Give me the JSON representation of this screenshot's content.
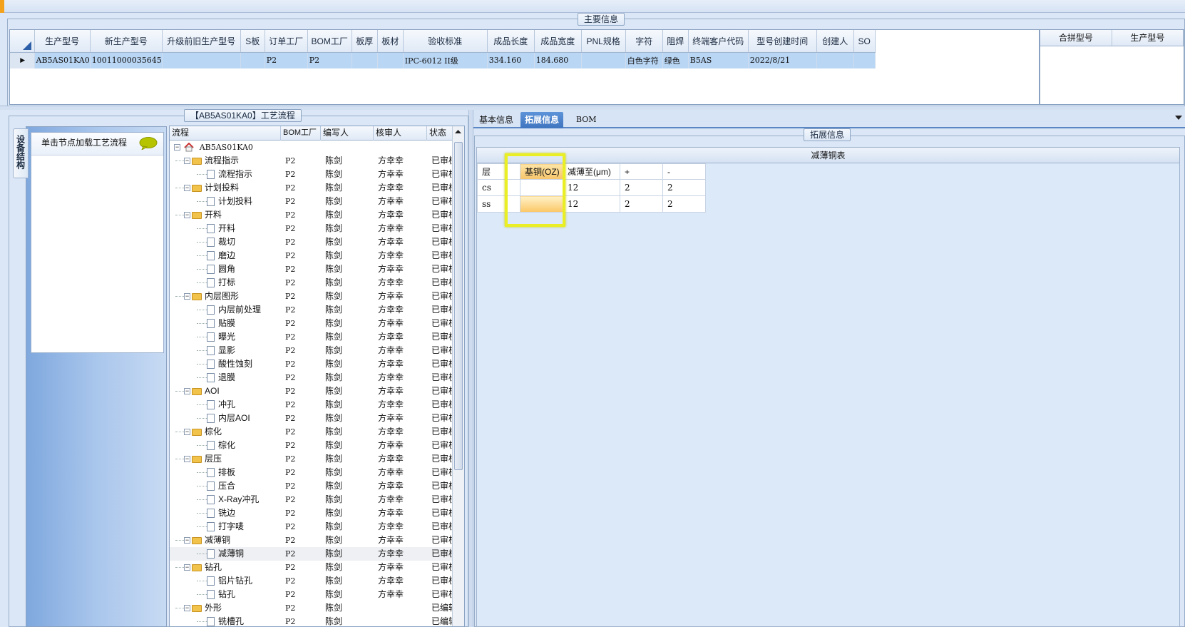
{
  "main_info": {
    "title": "主要信息",
    "columns": [
      "生产型号",
      "新生产型号",
      "升级前旧生产型号",
      "S板",
      "订单工厂",
      "BOM工厂",
      "板厚",
      "板材",
      "验收标准",
      "成品长度",
      "成品宽度",
      "PNL规格",
      "字符",
      "阻焊",
      "终端客户代码",
      "型号创建时间",
      "创建人",
      "SO"
    ],
    "row": [
      "AB5AS01KA0",
      "10011000035645",
      "",
      "",
      "P2",
      "P2",
      "",
      "",
      "IPC-6012 II级",
      "334.160",
      "184.680",
      "",
      "白色字符",
      "绿色",
      "B5AS",
      "2022/8/21",
      "",
      ""
    ]
  },
  "merge_panel": {
    "columns": [
      "合拼型号",
      "生产型号"
    ]
  },
  "process_flow": {
    "title": "【AB5AS01KA0】工艺流程",
    "side_tab": "设备结构",
    "hint": "单击节点加载工艺流程",
    "columns": [
      "流程",
      "BOM工厂",
      "编写人",
      "核审人",
      "状态"
    ],
    "root": "AB5AS01KA0",
    "rows": [
      {
        "label": "流程指示",
        "level": 1,
        "bom": "P2",
        "editor": "陈剑",
        "reviewer": "方幸幸",
        "status": "已审核"
      },
      {
        "label": "流程指示",
        "level": 2,
        "bom": "P2",
        "editor": "陈剑",
        "reviewer": "方幸幸",
        "status": "已审核"
      },
      {
        "label": "计划投料",
        "level": 1,
        "bom": "P2",
        "editor": "陈剑",
        "reviewer": "方幸幸",
        "status": "已审核"
      },
      {
        "label": "计划投料",
        "level": 2,
        "bom": "P2",
        "editor": "陈剑",
        "reviewer": "方幸幸",
        "status": "已审核"
      },
      {
        "label": "开料",
        "level": 1,
        "bom": "P2",
        "editor": "陈剑",
        "reviewer": "方幸幸",
        "status": "已审核"
      },
      {
        "label": "开料",
        "level": 2,
        "bom": "P2",
        "editor": "陈剑",
        "reviewer": "方幸幸",
        "status": "已审核"
      },
      {
        "label": "裁切",
        "level": 2,
        "bom": "P2",
        "editor": "陈剑",
        "reviewer": "方幸幸",
        "status": "已审核"
      },
      {
        "label": "磨边",
        "level": 2,
        "bom": "P2",
        "editor": "陈剑",
        "reviewer": "方幸幸",
        "status": "已审核"
      },
      {
        "label": "圆角",
        "level": 2,
        "bom": "P2",
        "editor": "陈剑",
        "reviewer": "方幸幸",
        "status": "已审核"
      },
      {
        "label": "打标",
        "level": 2,
        "bom": "P2",
        "editor": "陈剑",
        "reviewer": "方幸幸",
        "status": "已审核"
      },
      {
        "label": "内层图形",
        "level": 1,
        "bom": "P2",
        "editor": "陈剑",
        "reviewer": "方幸幸",
        "status": "已审核"
      },
      {
        "label": "内层前处理",
        "level": 2,
        "bom": "P2",
        "editor": "陈剑",
        "reviewer": "方幸幸",
        "status": "已审核"
      },
      {
        "label": "贴膜",
        "level": 2,
        "bom": "P2",
        "editor": "陈剑",
        "reviewer": "方幸幸",
        "status": "已审核"
      },
      {
        "label": "曝光",
        "level": 2,
        "bom": "P2",
        "editor": "陈剑",
        "reviewer": "方幸幸",
        "status": "已审核"
      },
      {
        "label": "显影",
        "level": 2,
        "bom": "P2",
        "editor": "陈剑",
        "reviewer": "方幸幸",
        "status": "已审核"
      },
      {
        "label": "酸性蚀刻",
        "level": 2,
        "bom": "P2",
        "editor": "陈剑",
        "reviewer": "方幸幸",
        "status": "已审核"
      },
      {
        "label": "退膜",
        "level": 2,
        "bom": "P2",
        "editor": "陈剑",
        "reviewer": "方幸幸",
        "status": "已审核"
      },
      {
        "label": "AOI",
        "level": 1,
        "bom": "P2",
        "editor": "陈剑",
        "reviewer": "方幸幸",
        "status": "已审核"
      },
      {
        "label": "冲孔",
        "level": 2,
        "bom": "P2",
        "editor": "陈剑",
        "reviewer": "方幸幸",
        "status": "已审核"
      },
      {
        "label": "内层AOI",
        "level": 2,
        "bom": "P2",
        "editor": "陈剑",
        "reviewer": "方幸幸",
        "status": "已审核"
      },
      {
        "label": "棕化",
        "level": 1,
        "bom": "P2",
        "editor": "陈剑",
        "reviewer": "方幸幸",
        "status": "已审核"
      },
      {
        "label": "棕化",
        "level": 2,
        "bom": "P2",
        "editor": "陈剑",
        "reviewer": "方幸幸",
        "status": "已审核"
      },
      {
        "label": "层压",
        "level": 1,
        "bom": "P2",
        "editor": "陈剑",
        "reviewer": "方幸幸",
        "status": "已审核"
      },
      {
        "label": "排板",
        "level": 2,
        "bom": "P2",
        "editor": "陈剑",
        "reviewer": "方幸幸",
        "status": "已审核"
      },
      {
        "label": "压合",
        "level": 2,
        "bom": "P2",
        "editor": "陈剑",
        "reviewer": "方幸幸",
        "status": "已审核"
      },
      {
        "label": "X-Ray冲孔",
        "level": 2,
        "bom": "P2",
        "editor": "陈剑",
        "reviewer": "方幸幸",
        "status": "已审核"
      },
      {
        "label": "铣边",
        "level": 2,
        "bom": "P2",
        "editor": "陈剑",
        "reviewer": "方幸幸",
        "status": "已审核"
      },
      {
        "label": "打字唛",
        "level": 2,
        "bom": "P2",
        "editor": "陈剑",
        "reviewer": "方幸幸",
        "status": "已审核"
      },
      {
        "label": "减薄铜",
        "level": 1,
        "bom": "P2",
        "editor": "陈剑",
        "reviewer": "方幸幸",
        "status": "已审核"
      },
      {
        "label": "减薄铜",
        "level": 2,
        "bom": "P2",
        "editor": "陈剑",
        "reviewer": "方幸幸",
        "status": "已审核",
        "selected": true
      },
      {
        "label": "钻孔",
        "level": 1,
        "bom": "P2",
        "editor": "陈剑",
        "reviewer": "方幸幸",
        "status": "已审核"
      },
      {
        "label": "铝片钻孔",
        "level": 2,
        "bom": "P2",
        "editor": "陈剑",
        "reviewer": "方幸幸",
        "status": "已审核"
      },
      {
        "label": "钻孔",
        "level": 2,
        "bom": "P2",
        "editor": "陈剑",
        "reviewer": "方幸幸",
        "status": "已审核"
      },
      {
        "label": "外形",
        "level": 1,
        "bom": "P2",
        "editor": "陈剑",
        "reviewer": "",
        "status": "已编辑"
      },
      {
        "label": "铣槽孔",
        "level": 2,
        "bom": "P2",
        "editor": "陈剑",
        "reviewer": "",
        "status": "已编辑"
      }
    ]
  },
  "tabs": [
    "基本信息",
    "拓展信息",
    "BOM"
  ],
  "active_tab": "拓展信息",
  "ext_info": {
    "title": "拓展信息",
    "table_caption": "减薄铜表",
    "columns": [
      "层",
      "基铜(OZ)",
      "减薄至(μm)",
      "+",
      "-"
    ],
    "rows": [
      [
        "cs",
        "",
        "12",
        "2",
        "2"
      ],
      [
        "ss",
        "",
        "12",
        "2",
        "2"
      ]
    ]
  },
  "colors": {
    "selection": "#b9d6f5",
    "active_tab": "#3f74bf",
    "highlight_frame": "#e9ef24",
    "folder": "#f2c34a"
  }
}
